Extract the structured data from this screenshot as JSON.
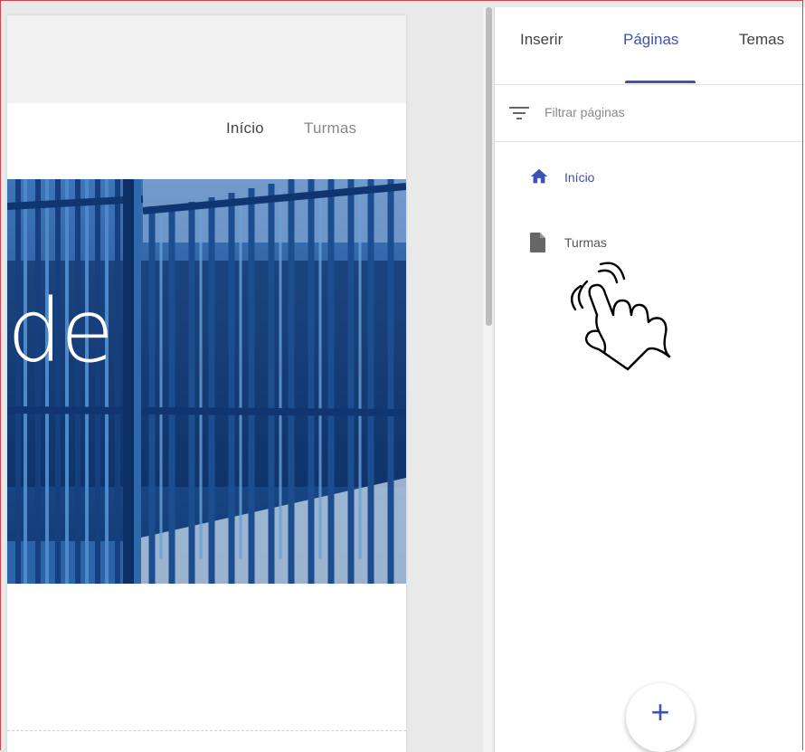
{
  "preview": {
    "nav": {
      "home": "Início",
      "classes": "Turmas"
    },
    "hero_text": "de"
  },
  "side_panel": {
    "tabs": [
      {
        "label": "Inserir"
      },
      {
        "label": "Páginas",
        "active": true
      },
      {
        "label": "Temas"
      }
    ],
    "filter": {
      "placeholder": "Filtrar páginas",
      "icon": "filter-icon"
    },
    "pages": [
      {
        "label": "Início",
        "icon": "home-icon",
        "selected": true
      },
      {
        "label": "Turmas",
        "icon": "page-icon"
      }
    ],
    "fab": {
      "label": "+",
      "icon": "add-icon"
    }
  },
  "colors": {
    "accent": "#3f51b5",
    "hero_bg": "#0d3772",
    "frame": "#d9434f"
  }
}
